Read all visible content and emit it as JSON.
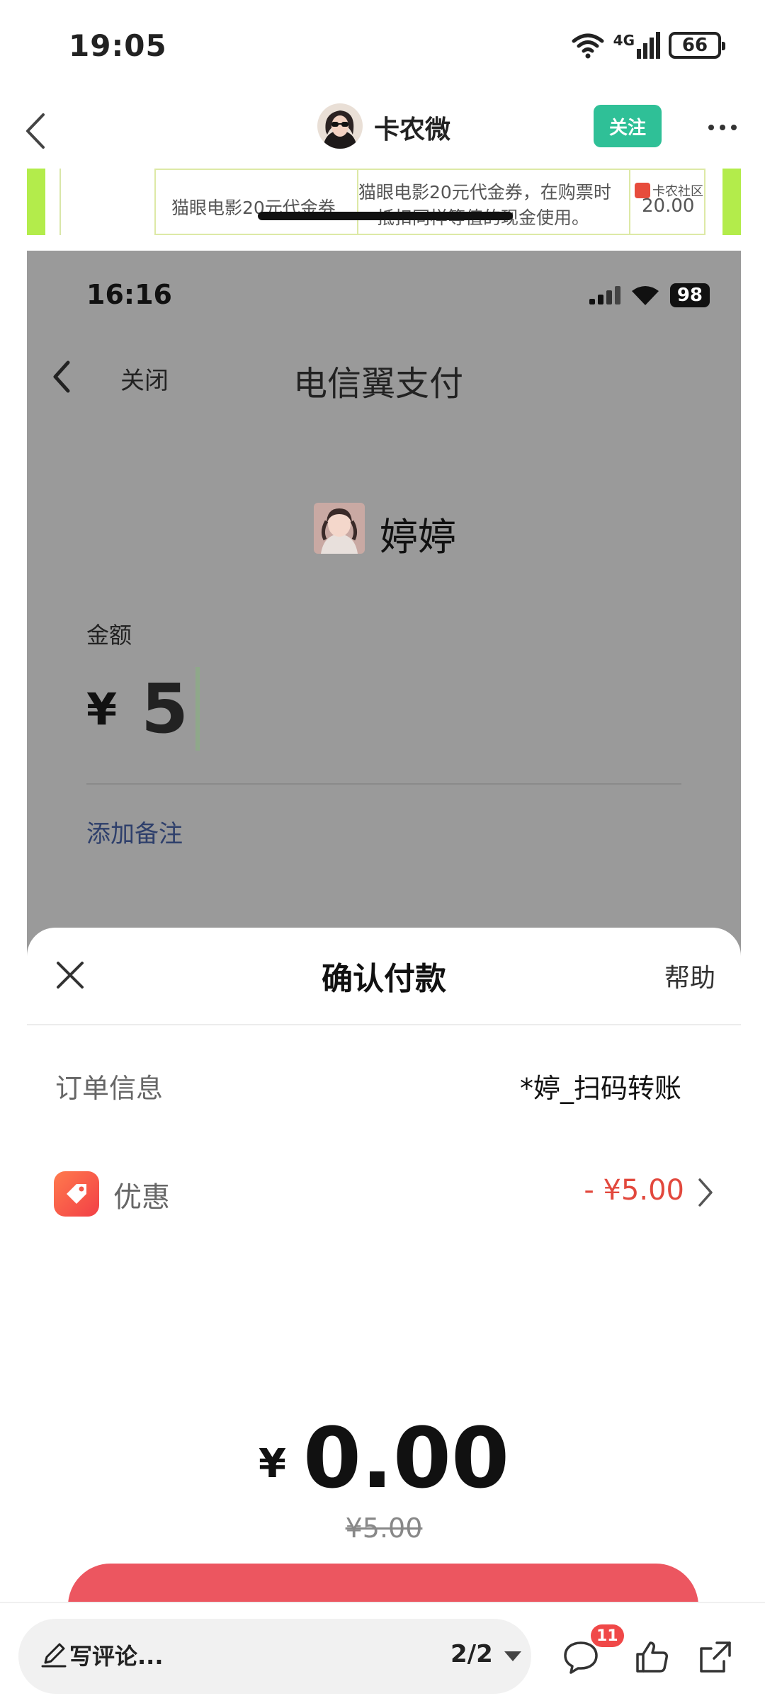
{
  "status_bar": {
    "time": "19:05",
    "network": "4G",
    "battery": "66"
  },
  "post_header": {
    "author": "卡农微",
    "follow_label": "关注"
  },
  "ad": {
    "card1_text": "猫眼电影20元代金券",
    "card2_line1": "猫眼电影20元代金券，在购票时",
    "card2_line2": "抵扣同样等值的现金使用。",
    "brand": "卡农社区",
    "price": "20.00"
  },
  "inner": {
    "status_time": "16:16",
    "battery": "98",
    "close_label": "关闭",
    "title": "电信翼支付",
    "payee": "婷婷",
    "amount_label": "金额",
    "currency": "¥",
    "amount": "5",
    "add_note": "添加备注"
  },
  "sheet": {
    "title": "确认付款",
    "help": "帮助",
    "order_label": "订单信息",
    "order_value": "*婷_扫码转账",
    "promo_label": "优惠",
    "promo_value": "- ¥5.00",
    "pay_currency": "¥",
    "pay_amount": "0.00",
    "original_amount": "¥5.00"
  },
  "bottom_bar": {
    "comment_placeholder": "写评论...",
    "page_indicator": "2/2",
    "comment_count": "11"
  },
  "colors": {
    "follow": "#2fc097",
    "discount": "#e2483d",
    "confirm": "#ec5660",
    "ad_accent": "#b3ec4b"
  }
}
